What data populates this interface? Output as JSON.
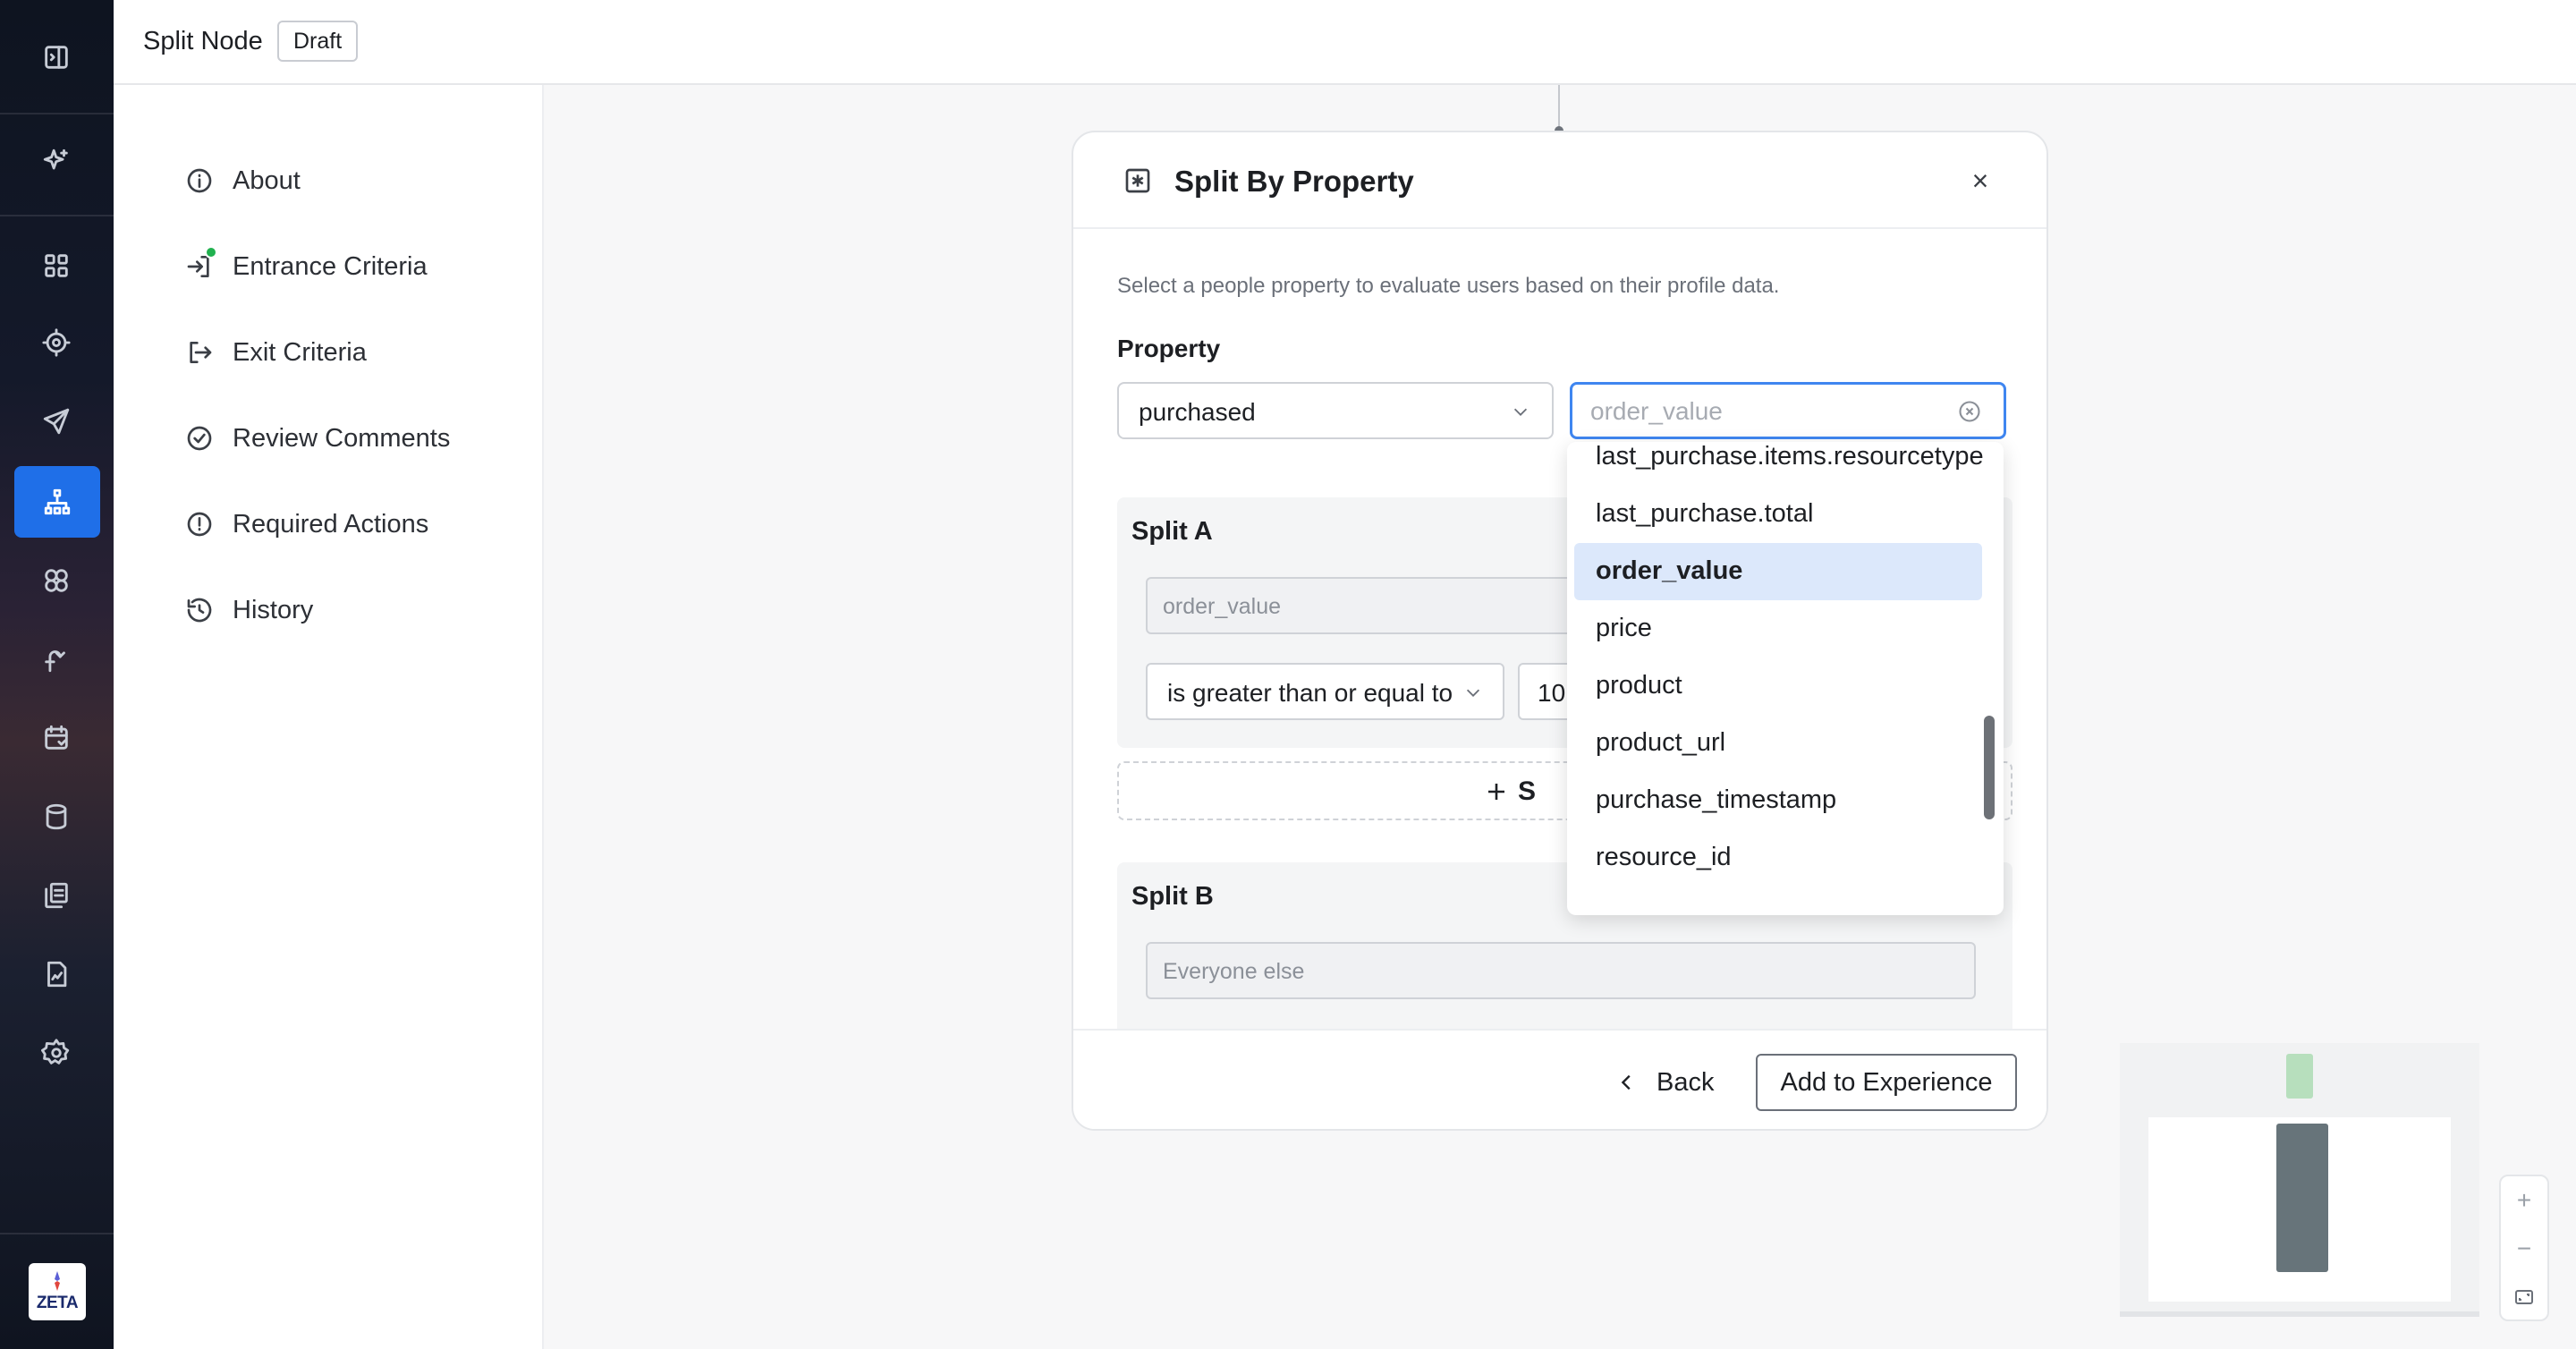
{
  "header": {
    "title": "Split Node",
    "badge": "Draft"
  },
  "rail": {
    "icons": [
      "collapse-sidebar-icon",
      "sparkle-icon",
      "dashboard-icon",
      "target-icon",
      "send-icon",
      "hierarchy-icon",
      "segments-icon",
      "journey-icon",
      "calendar-icon",
      "database-icon",
      "library-icon",
      "report-icon",
      "settings-icon"
    ],
    "active": "hierarchy-icon",
    "logo_text": "ZETA"
  },
  "sidenav": {
    "items": [
      {
        "label": "About",
        "icon": "info-icon"
      },
      {
        "label": "Entrance Criteria",
        "icon": "entrance-icon",
        "status_dot": "#21b14f"
      },
      {
        "label": "Exit Criteria",
        "icon": "exit-icon"
      },
      {
        "label": "Review Comments",
        "icon": "check-circle-icon"
      },
      {
        "label": "Required Actions",
        "icon": "alert-icon"
      },
      {
        "label": "History",
        "icon": "history-icon"
      }
    ]
  },
  "modal": {
    "title": "Split By Property",
    "description": "Select a people property to evaluate users based on their profile data.",
    "property_label": "Property",
    "property_select": "purchased",
    "search": {
      "placeholder": "order_value",
      "value": ""
    },
    "split_a": {
      "title": "Split A",
      "field_placeholder": "order_value",
      "operator": "is greater than or equal to",
      "value": "10"
    },
    "add_split_label": "S",
    "split_b": {
      "title": "Split B",
      "field_placeholder": "Everyone else"
    },
    "back_label": "Back",
    "primary_label": "Add to Experience"
  },
  "dropdown": {
    "options": [
      "last_purchase.items.resourcetype",
      "last_purchase.total",
      "order_value",
      "price",
      "product",
      "product_url",
      "purchase_timestamp",
      "resource_id"
    ],
    "selected": "order_value"
  },
  "zoom": {
    "in": "+",
    "out": "−"
  },
  "colors": {
    "accent": "#1f6fe8",
    "focus": "#3f86f0",
    "selected_bg": "#dce8fb",
    "status_green": "#21b14f"
  }
}
